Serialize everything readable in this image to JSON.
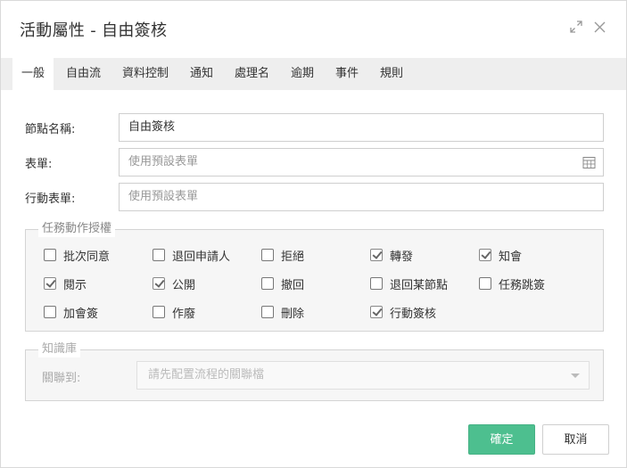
{
  "dialog": {
    "title": "活動屬性 - 自由簽核",
    "icons": {
      "expand": "expand-icon",
      "close": "close-icon"
    }
  },
  "tabs": [
    "一般",
    "自由流",
    "資料控制",
    "通知",
    "處理名",
    "逾期",
    "事件",
    "規則"
  ],
  "active_tab": "一般",
  "form": {
    "node_name_label": "節點名稱:",
    "node_name_value": "自由簽核",
    "form_label": "表單:",
    "form_placeholder": "使用預設表單",
    "form_icon": "calendar-grid-icon",
    "mobile_form_label": "行動表單:",
    "mobile_form_placeholder": "使用預設表單"
  },
  "permissions": {
    "legend": "任務動作授權",
    "items": [
      {
        "label": "批次同意",
        "checked": false
      },
      {
        "label": "退回申請人",
        "checked": false
      },
      {
        "label": "拒絕",
        "checked": false
      },
      {
        "label": "轉發",
        "checked": true
      },
      {
        "label": "知會",
        "checked": true
      },
      {
        "label": "閱示",
        "checked": true
      },
      {
        "label": "公開",
        "checked": true
      },
      {
        "label": "撤回",
        "checked": false
      },
      {
        "label": "退回某節點",
        "checked": false
      },
      {
        "label": "任務跳簽",
        "checked": false
      },
      {
        "label": "加會簽",
        "checked": false
      },
      {
        "label": "作廢",
        "checked": false
      },
      {
        "label": "刪除",
        "checked": false
      },
      {
        "label": "行動簽核",
        "checked": true
      }
    ]
  },
  "knowledge": {
    "legend": "知識庫",
    "link_label": "關聯到:",
    "select_placeholder": "請先配置流程的關聯檔"
  },
  "buttons": {
    "ok": "確定",
    "cancel": "取消"
  },
  "colors": {
    "primary": "#4dbf8f",
    "tabbar": "#eeeeee"
  }
}
